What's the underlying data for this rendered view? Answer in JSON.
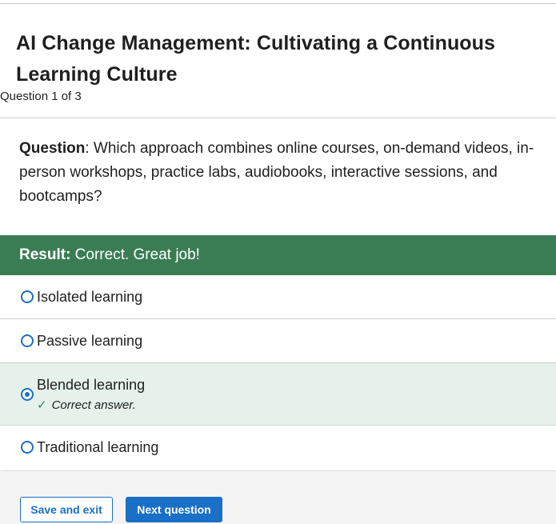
{
  "quiz": {
    "title": "AI Change Management: Cultivating a Continuous Learning Culture",
    "counter": "Question 1 of 3"
  },
  "question": {
    "prefix": "Question",
    "text": ": Which approach combines online courses, on-demand videos, in-person workshops, practice labs, audiobooks, interactive sessions, and bootcamps?"
  },
  "result": {
    "prefix": "Result:",
    "text": " Correct. Great job!",
    "color": "#3a7d55"
  },
  "options": [
    {
      "label": "Isolated learning",
      "selected": false
    },
    {
      "label": "Passive learning",
      "selected": false
    },
    {
      "label": "Blended learning",
      "selected": true,
      "feedback": "Correct answer."
    },
    {
      "label": "Traditional learning",
      "selected": false
    }
  ],
  "footer": {
    "save_label": "Save and exit",
    "next_label": "Next question"
  },
  "colors": {
    "accent": "#1a6fc6",
    "selected_bg": "#e6f1ec"
  }
}
